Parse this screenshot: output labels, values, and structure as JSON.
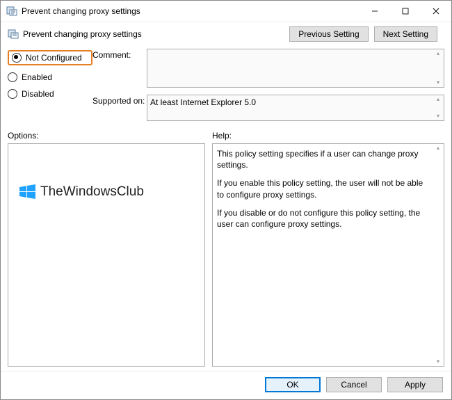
{
  "window": {
    "title": "Prevent changing proxy settings"
  },
  "subheader": {
    "title": "Prevent changing proxy settings",
    "prev_label": "Previous Setting",
    "next_label": "Next Setting"
  },
  "radios": {
    "not_configured": "Not Configured",
    "enabled": "Enabled",
    "disabled": "Disabled",
    "selected": "not_configured"
  },
  "fields": {
    "comment_label": "Comment:",
    "comment_value": "",
    "supported_label": "Supported on:",
    "supported_value": "At least Internet Explorer 5.0"
  },
  "panels": {
    "options_label": "Options:",
    "help_label": "Help:"
  },
  "help": {
    "p1": "This policy setting specifies if a user can change proxy settings.",
    "p2": "If you enable this policy setting, the user will not be able to configure proxy settings.",
    "p3": "If you disable or do not configure this policy setting, the user can configure proxy settings."
  },
  "watermark": {
    "text": "TheWindowsClub"
  },
  "footer": {
    "ok": "OK",
    "cancel": "Cancel",
    "apply": "Apply"
  }
}
